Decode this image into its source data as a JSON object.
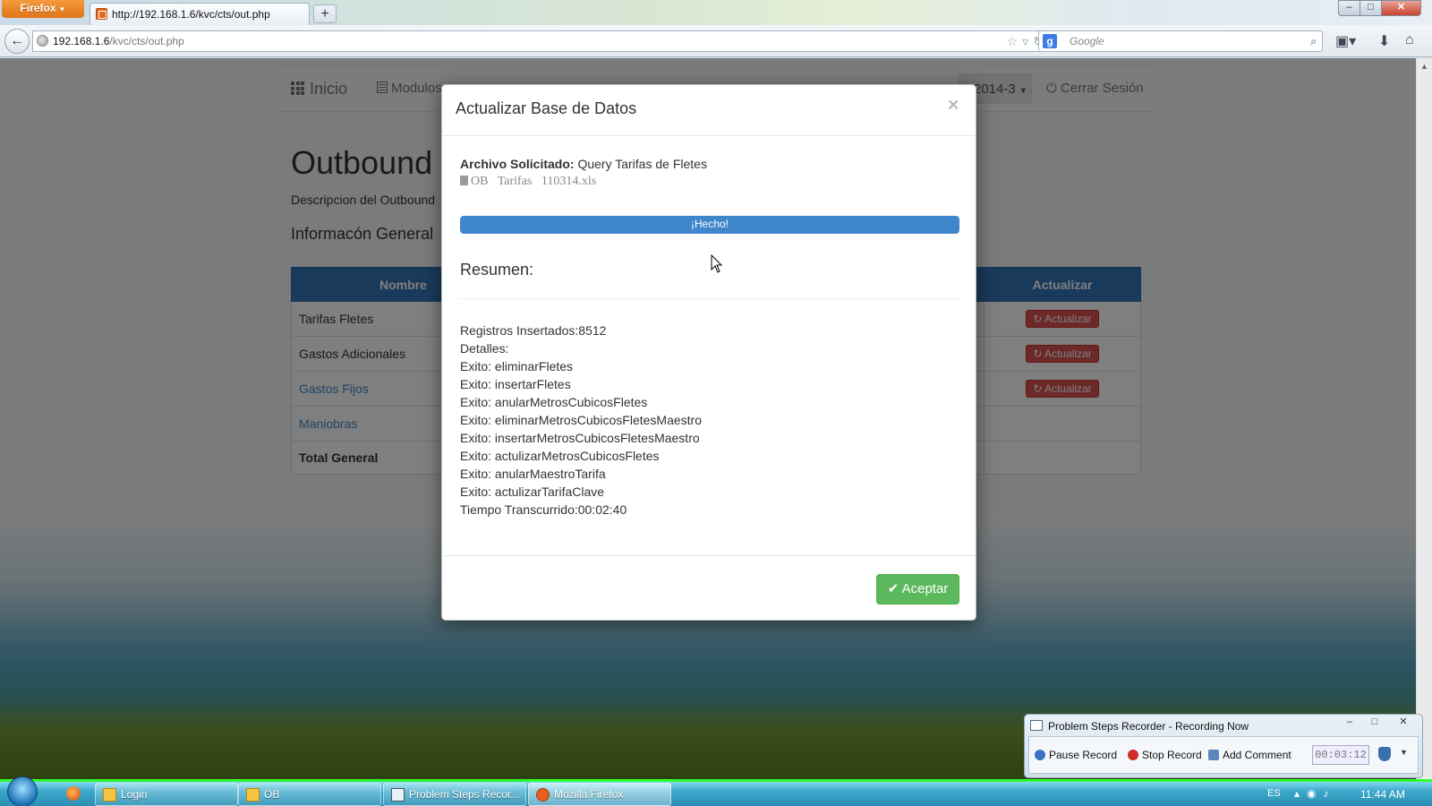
{
  "browser": {
    "menu_label": "Firefox",
    "tab_title": "http://192.168.1.6/kvc/cts/out.php",
    "new_tab": "+",
    "url_host": "192.168.1.6",
    "url_path": "/kvc/cts/out.php",
    "search_placeholder": "Google",
    "window_controls": {
      "minimize": "–",
      "maximize": "□",
      "close": "✕"
    }
  },
  "nav": {
    "inicio": "Inicio",
    "modulos": "Modulos",
    "period": "2014-3",
    "logout": "Cerrar Sesión"
  },
  "page": {
    "title": "Outbound",
    "description": "Descripcion del Outbound",
    "section_title": "Informacón General"
  },
  "table": {
    "headers": {
      "name": "Nombre",
      "update": "Actualizar"
    },
    "rows": [
      {
        "name": "Tarifas Fletes",
        "action": "Actualizar"
      },
      {
        "name": "Gastos Adicionales",
        "action": "Actualizar"
      },
      {
        "name": "Gastos Fijos",
        "action": "Actualizar"
      },
      {
        "name": "Maniobras",
        "action": ""
      }
    ],
    "total_label": "Total General"
  },
  "modal": {
    "title": "Actualizar Base de Datos",
    "close": "×",
    "file_label": "Archivo Solicitado:",
    "file_value": "Query Tarifas de Fletes",
    "file_name": "OB   Tarifas   110314.xls",
    "progress_label": "¡Hecho!",
    "progress_percent": 100,
    "summary_title": "Resumen:",
    "summary_lines": [
      "Registros Insertados:8512",
      "Detalles:",
      "Exito: eliminarFletes",
      "Exito: insertarFletes",
      "Exito: anularMetrosCubicosFletes",
      "Exito: eliminarMetrosCubicosFletesMaestro",
      "Exito: insertarMetrosCubicosFletesMaestro",
      "Exito: actulizarMetrosCubicosFletes",
      "Exito: anularMaestroTarifa",
      "Exito: actulizarTarifaClave",
      "Tiempo Transcurrido:00:02:40"
    ],
    "accept_label": "Aceptar"
  },
  "recorder": {
    "title": "Problem Steps Recorder - Recording Now",
    "pause": "Pause Record",
    "stop": "Stop Record",
    "comment": "Add Comment",
    "elapsed": "00:03:12"
  },
  "taskbar": {
    "items": [
      "Login",
      "OB",
      "Problem Steps Recor...",
      "Mozilla Firefox"
    ],
    "lang": "ES",
    "clock": "11:44 AM"
  },
  "colors": {
    "primary": "#3575b8",
    "danger": "#d9534f",
    "success": "#5cb85c",
    "progress": "#3f86cb"
  }
}
